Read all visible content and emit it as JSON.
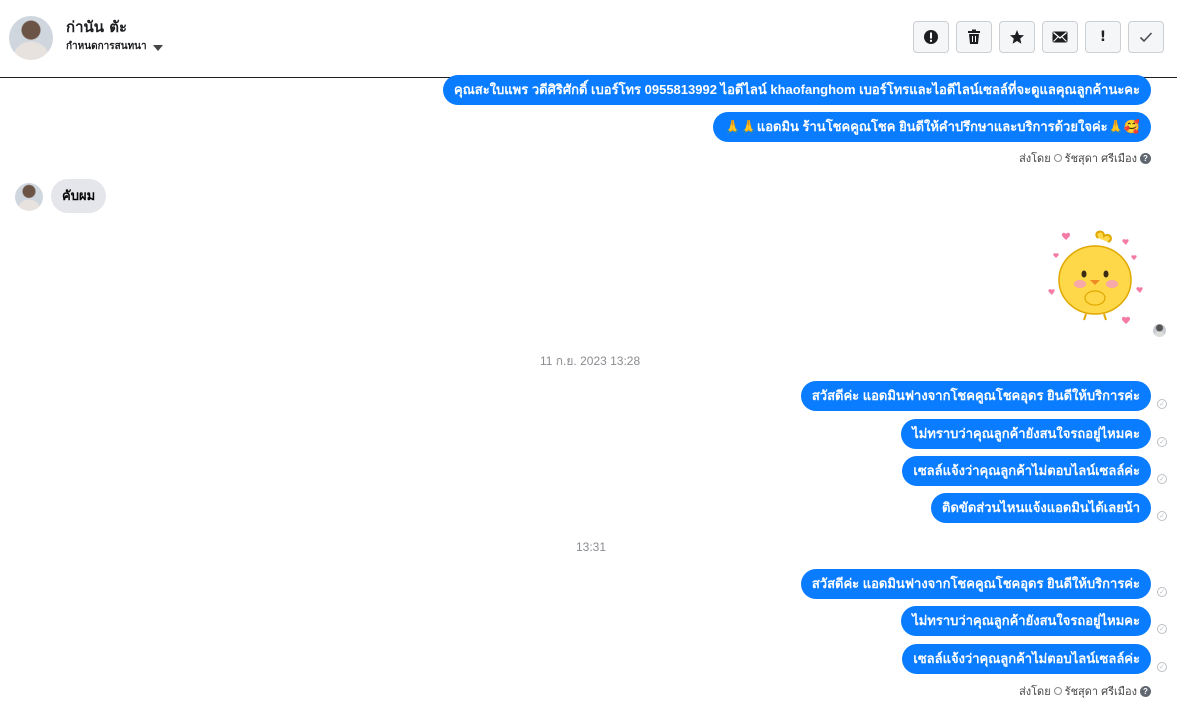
{
  "header": {
    "contact_name": "ก่านัน ตัะ",
    "conversation_settings": "กำหนดการสนทนา",
    "toolbar": [
      {
        "name": "alert-button",
        "icon": "exclamation-circle-icon"
      },
      {
        "name": "delete-button",
        "icon": "trash-icon"
      },
      {
        "name": "star-button",
        "icon": "star-icon"
      },
      {
        "name": "mail-button",
        "icon": "envelope-icon"
      },
      {
        "name": "important-button",
        "icon": "exclamation-icon",
        "label": "!"
      },
      {
        "name": "done-button",
        "icon": "checkmark-icon"
      }
    ]
  },
  "messages": {
    "out_1": "คุณสะใบแพร วดีศิริศักดิ์ เบอร์โทร 0955813992 ไอดีไลน์ khaofanghom เบอร์โทรและไอดีไลน์เซลล์ที่จะดูแลคุณลูกค้านะคะ",
    "out_2": "🙏🙏แอดมิน ร้านโชคคูณโชค ยินดีให้คำปรึกษาและบริการด้วยใจค่ะ🙏🥰",
    "sent_by_prefix": "ส่งโดย",
    "sent_by_name": "รัชสุดา ศรีเมือง",
    "in_1": "คับผม",
    "timestamp_1": "11 ก.ย. 2023 13:28",
    "group1": [
      "สวัสดีค่ะ แอดมินฟางจากโชคคูณโชคอุดร ยินดีให้บริการค่ะ",
      "ไม่ทราบว่าคุณลูกค้ายังสนใจรถอยู่ไหมคะ",
      "เซลล์แจ้งว่าคุณลูกค้าไม่ตอบไลน์เซลล์ค่ะ",
      "ติดขัดส่วนไหนแจ้งแอดมินได้เลยน้า"
    ],
    "timestamp_2": "13:31",
    "group2": [
      "สวัสดีค่ะ แอดมินฟางจากโชคคูณโชคอุดร ยินดีให้บริการค่ะ",
      "ไม่ทราบว่าคุณลูกค้ายังสนใจรถอยู่ไหมคะ",
      "เซลล์แจ้งว่าคุณลูกค้าไม่ตอบไลน์เซลล์ค่ะ"
    ]
  },
  "colors": {
    "bubble_out": "#0a7cff",
    "bubble_in": "#e4e6eb",
    "toolbar_bg": "#f5f6f7"
  }
}
